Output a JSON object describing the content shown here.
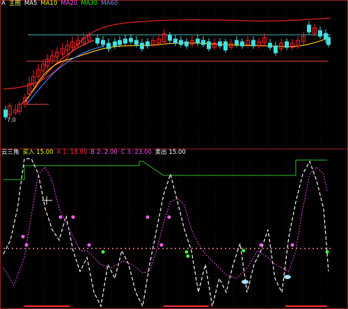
{
  "price_panel": {
    "header": [
      {
        "text": "A",
        "color": "#ffffff"
      },
      {
        "text": "主图",
        "color": "#ffff55"
      },
      {
        "text": "MA5",
        "color": "#ffffff"
      },
      {
        "text": "MA10",
        "color": "#ffff00"
      },
      {
        "text": "MA20",
        "color": "#ff55ff"
      },
      {
        "text": "MA30",
        "color": "#00ff00"
      },
      {
        "text": "MA60",
        "color": "#8888ff"
      }
    ],
    "price_label": "7.0",
    "colors": {
      "upper_band": "#e02020",
      "mid_band": "#ff4040",
      "ma_fast": "#ffcc00",
      "ma_slow": "#4080ff",
      "level": "#ff4444",
      "teal_level": "#40c0c0",
      "up_candle": "#ff2020",
      "down_candle": "#40e0e0"
    }
  },
  "indicator_panel": {
    "header": [
      {
        "text": "云三角",
        "color": "#ffffff"
      },
      {
        "text": "买入 15.00",
        "color": "#ffff00"
      },
      {
        "text": "A 1: 18.00",
        "color": "#ff3030"
      },
      {
        "text": "B 2: 2.00",
        "color": "#ff55ff"
      },
      {
        "text": "C 3: 23.00",
        "color": "#ff40ff"
      },
      {
        "text": "卖出 15.00",
        "color": "#ffffff"
      }
    ],
    "colors": {
      "white_line": "#ffffff",
      "magenta_line": "#d040d0",
      "green_line": "#30c030",
      "baseline_dots": "#ff8888",
      "marker_green": "#40ff40",
      "marker_magenta": "#ff60ff"
    }
  }
}
